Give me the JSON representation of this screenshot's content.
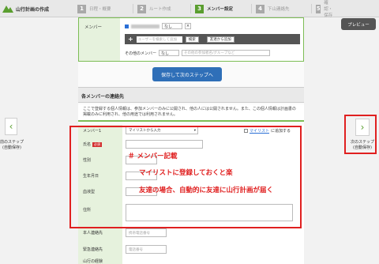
{
  "app": {
    "title": "山行計画の作成"
  },
  "steps": [
    {
      "num": "1",
      "label": "日程・概要",
      "active": false
    },
    {
      "num": "2",
      "label": "ルート作成",
      "active": false
    },
    {
      "num": "3",
      "label": "メンバー設定",
      "active": true
    },
    {
      "num": "4",
      "label": "下山連絡先",
      "active": false
    },
    {
      "num": "5",
      "label": "確認・保存",
      "active": false
    }
  ],
  "preview_label": "プレビュー",
  "member": {
    "label": "メンバー",
    "role_value": "なし",
    "search_placeholder": "ユーザーを検索して追加",
    "search_button": "検索",
    "add_friend_button": "友達から追加",
    "other_label": "その他のメンバー",
    "other_select_value": "なし",
    "other_placeholder": "その他の参加者名/グループなど"
  },
  "save_next_label": "保存して次のステップへ",
  "contact": {
    "heading": "各メンバーの連絡先",
    "notice": "ここで登録する個人情報は、参加メンバーのみに公開され、他の人には公開されません。また、この個人情報は計画書の掲載のみに利用され、他の用途では利用されません。"
  },
  "form": {
    "member_label": "メンバー1",
    "member_select": "マイリストから入力",
    "mylist_link": "マイリスト",
    "mylist_suffix": "に追加する",
    "name_label": "氏名",
    "required_badge": "必須",
    "gender_label": "性別",
    "birthday_label": "生年月日",
    "blood_label": "血液型",
    "address_label": "住所",
    "personal_contact_label": "本人連絡先",
    "personal_contact_placeholder": "携帯電話番号",
    "emergency_label": "緊急連絡先",
    "emergency_placeholder": "電話番号",
    "last_label": "山行の経験"
  },
  "nav": {
    "prev_label": "前のステップ",
    "prev_sub": "(自動保存)",
    "next_label": "次のステップ",
    "next_sub": "(自動保存)"
  },
  "annotations": {
    "line1": "＃ メンバー記載",
    "line2": "マイリストに登録しておくと楽",
    "line3": "友達の場合、自動的に友達に山行計画が届く",
    "color": "#e02020"
  }
}
